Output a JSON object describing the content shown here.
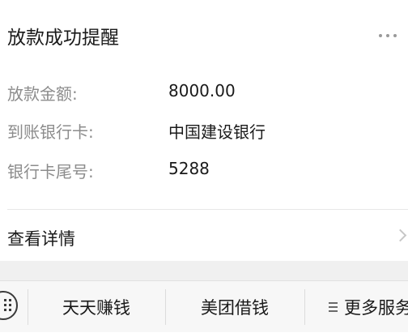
{
  "card": {
    "title": "放款成功提醒",
    "more_icon": "more-dots-icon",
    "fields": [
      {
        "label": "放款金额:",
        "value": "8000.00"
      },
      {
        "label": "到账银行卡:",
        "value": "中国建设银行"
      },
      {
        "label": "银行卡尾号:",
        "value": "5288"
      }
    ],
    "detail_label": "查看详情",
    "detail_icon": "chevron-right-icon"
  },
  "tabbar": {
    "keyboard_icon": "keyboard-icon",
    "items": [
      {
        "label": "天天赚钱"
      },
      {
        "label": "美团借钱"
      },
      {
        "label": "更多服务",
        "icon": "menu-icon"
      }
    ]
  }
}
